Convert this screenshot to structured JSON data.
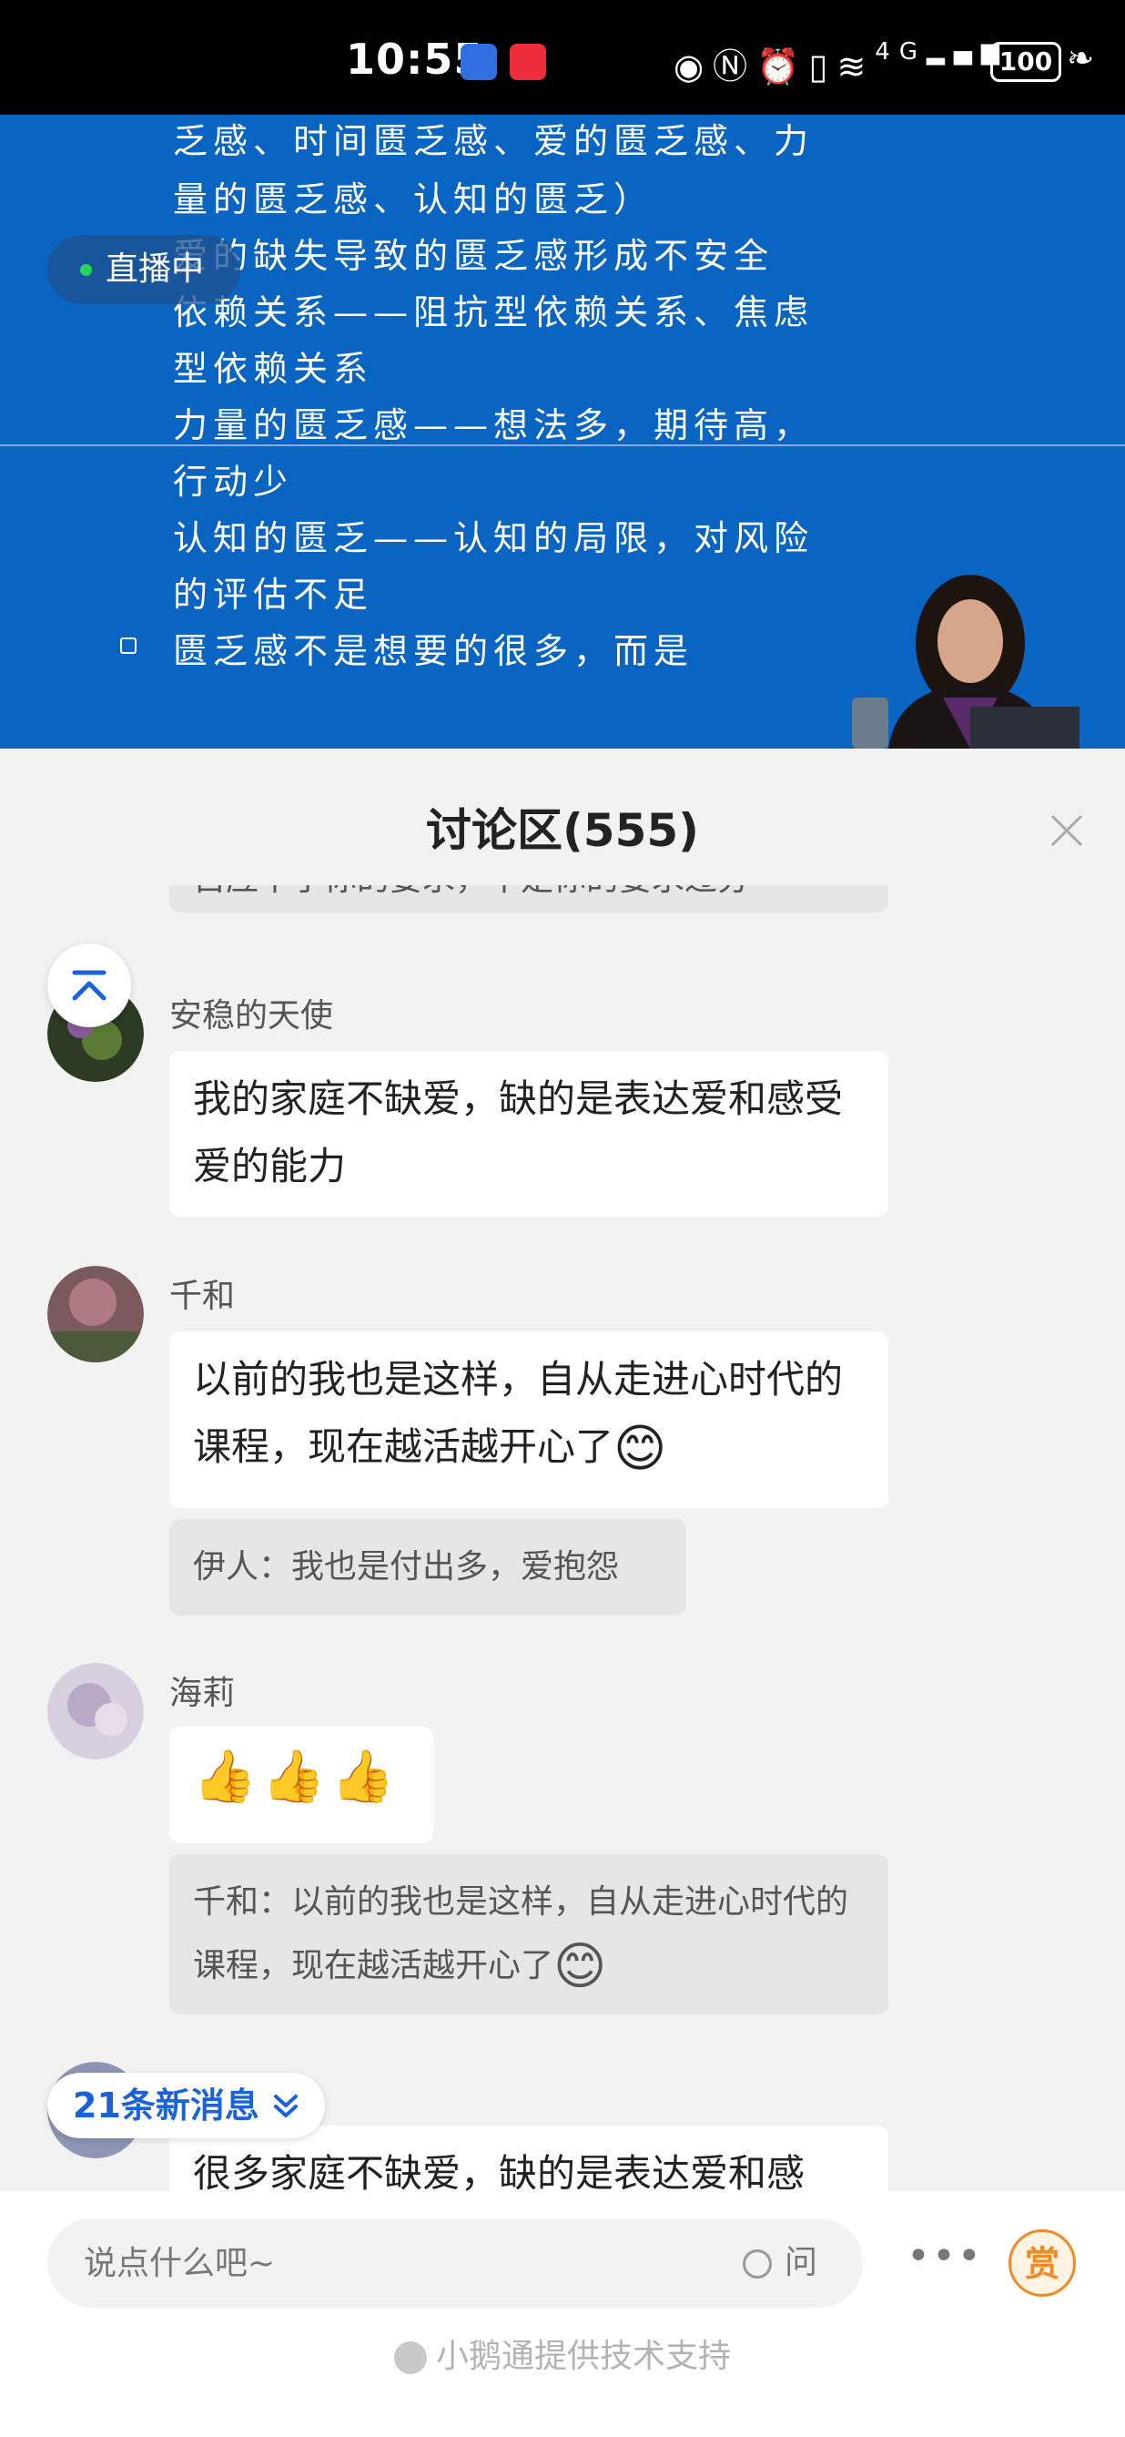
{
  "status_bar": {
    "time": "10:55",
    "network": "4G",
    "battery": "100"
  },
  "video": {
    "live_badge": "直播中",
    "slide_lines": [
      "乏感、时间匮乏感、爱的匮乏感、力",
      "量的匮乏感、认知的匮乏）",
      "爱的缺失导致的匮乏感形成不安全",
      "依赖关系——阻抗型依赖关系、焦虑",
      "型依赖关系",
      "力量的匮乏感——想法多，期待高，",
      "行动少",
      "认知的匮乏——认知的局限，对风险",
      "的评估不足",
      "匮乏感不是想要的很多，而是"
    ]
  },
  "discussion": {
    "title": "讨论区(555)",
    "partial_top_quote": "自应不了你的要求，不是你的要求过分",
    "messages": [
      {
        "user": "安稳的天使",
        "text": "我的家庭不缺爱，缺的是表达爱和感受爱的能力"
      },
      {
        "user": "千和",
        "text": "以前的我也是这样，自从走进心时代的课程，现在越活越开心了",
        "emoji": "😊",
        "quote": "伊人：我也是付出多，爱抱怨"
      },
      {
        "user": "海莉",
        "text": "👍👍👍",
        "quote": "千和：以前的我也是这样，自从走进心时代的课程，现在越活越开心了",
        "quote_emoji": "😊"
      },
      {
        "user": "",
        "text": "很多家庭不缺爱，缺的是表达爱和感"
      }
    ],
    "new_messages_label": "21条新消息"
  },
  "bottom_bar": {
    "input_placeholder": "说点什么吧~",
    "ask_label": "问",
    "reward_label": "赏",
    "powered_by": "小鹅通提供技术支持"
  },
  "colors": {
    "slide_bg": "#0a64c2",
    "accent_blue": "#1a62d9",
    "reward_orange": "#f08a24",
    "live_dot": "#27d45f"
  }
}
